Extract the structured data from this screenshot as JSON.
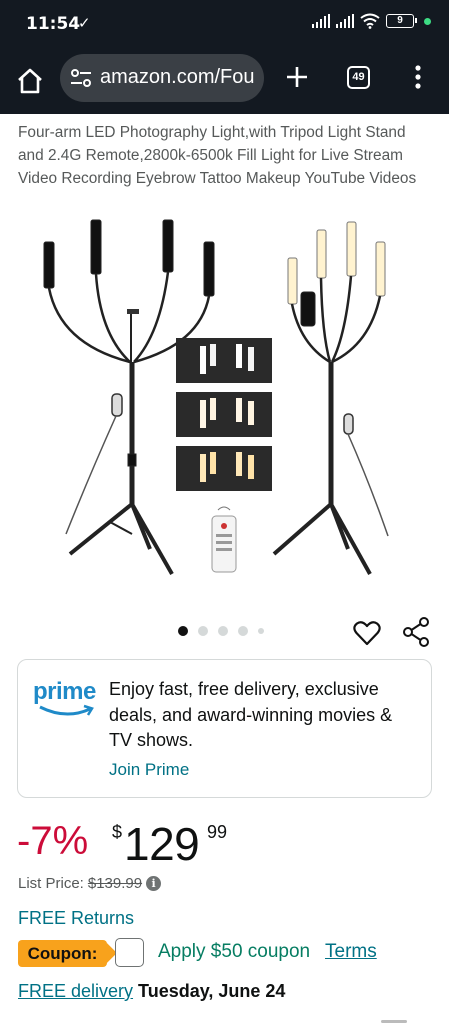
{
  "status_bar": {
    "time": "11:54",
    "battery": "9",
    "check_icon": "check-download-icon"
  },
  "browser": {
    "url": "amazon.com/Fou",
    "tab_count": "49",
    "icons": [
      "home-icon",
      "site-settings-icon",
      "plus-icon",
      "tabs-icon",
      "more-vert-icon"
    ]
  },
  "product": {
    "title": "Four-arm LED Photography Light,with Tripod Light Stand and 2.4G Remote,2800k-6500k Fill Light for Live Stream Video Recording Eyebrow Tattoo Makeup YouTube Videos",
    "image_count": 5,
    "active_image": 1
  },
  "prime": {
    "logo": "prime",
    "message": "Enjoy fast, free delivery, exclusive deals, and award-winning movies & TV shows.",
    "join_label": "Join Prime",
    "brand_color": "#1f8ac8"
  },
  "price": {
    "discount": "-7%",
    "currency": "$",
    "whole": "129",
    "fraction": "99",
    "list_label": "List Price:",
    "list_value": "$139.99",
    "discount_color": "#cc0c39"
  },
  "returns": {
    "label": "FREE Returns"
  },
  "coupon": {
    "badge": "Coupon:",
    "text": "Apply $50 coupon",
    "terms": "Terms",
    "checked": false
  },
  "delivery": {
    "link": "FREE delivery",
    "date": "Tuesday, June 24"
  },
  "colors": {
    "header_bg": "#131921",
    "link": "#007185",
    "coupon_green": "#067d62",
    "coupon_badge": "#f8a21c"
  }
}
